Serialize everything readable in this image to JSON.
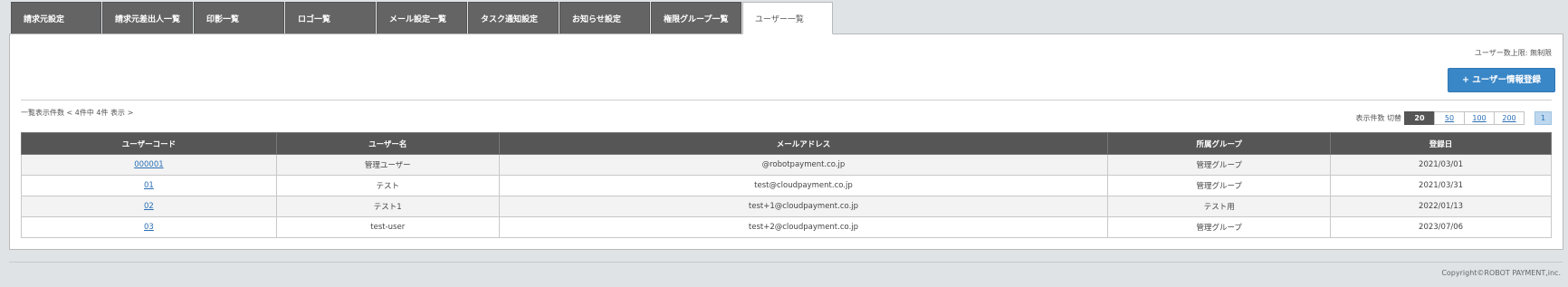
{
  "tabs": [
    {
      "label": "請求元設定",
      "active": false
    },
    {
      "label": "請求元差出人一覧",
      "active": false
    },
    {
      "label": "印影一覧",
      "active": false
    },
    {
      "label": "ロゴ一覧",
      "active": false
    },
    {
      "label": "メール設定一覧",
      "active": false
    },
    {
      "label": "タスク通知設定",
      "active": false
    },
    {
      "label": "お知らせ設定",
      "active": false
    },
    {
      "label": "権限グループ一覧",
      "active": false
    },
    {
      "label": "ユーザー一覧",
      "active": true
    }
  ],
  "header": {
    "user_limit": "ユーザー数上限: 無制限",
    "add_button": "+ ユーザー情報登録"
  },
  "list": {
    "count_text": "一覧表示件数 < 4件中 4件 表示 >",
    "page_size_label": "表示件数 切替",
    "page_sizes": [
      "20",
      "50",
      "100",
      "200"
    ],
    "selected_page_size": "20",
    "current_page": "1"
  },
  "table": {
    "columns": [
      "ユーザーコード",
      "ユーザー名",
      "メールアドレス",
      "所属グループ",
      "登録日"
    ],
    "rows": [
      {
        "code": "000001",
        "name": "管理ユーザー",
        "email": "@robotpayment.co.jp",
        "group": "管理グループ",
        "date": "2021/03/01"
      },
      {
        "code": "01",
        "name": "テスト",
        "email": "test@cloudpayment.co.jp",
        "group": "管理グループ",
        "date": "2021/03/31"
      },
      {
        "code": "02",
        "name": "テスト1",
        "email": "test+1@cloudpayment.co.jp",
        "group": "テスト用",
        "date": "2022/01/13"
      },
      {
        "code": "03",
        "name": "test-user",
        "email": "test+2@cloudpayment.co.jp",
        "group": "管理グループ",
        "date": "2023/07/06"
      }
    ]
  },
  "footer": {
    "copyright": "Copyright©ROBOT PAYMENT,inc."
  },
  "colors": {
    "tab_bg": "#646464",
    "primary_button": "#3a87c7",
    "table_header": "#565656",
    "link": "#2a6fb6"
  }
}
